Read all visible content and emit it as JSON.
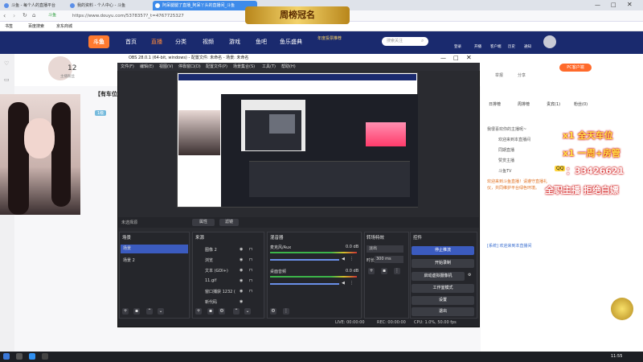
{
  "tabs": [
    {
      "label": "斗鱼 - 每个人的直播平台"
    },
    {
      "label": "我的资料 - 个人中心 - 斗鱼"
    },
    {
      "label": "阿呆腿腿了直播_阿呆丫头的直播间_斗鱼"
    }
  ],
  "address": {
    "secure_label": "斗鱼",
    "url": "https://www.douyu.com/5378357?_t=4767725327"
  },
  "bookmarks": [
    "书签",
    "百度搜索",
    "京东商城"
  ],
  "site": {
    "logo": "斗鱼",
    "nav": [
      "首页",
      "直播",
      "分类",
      "视频",
      "游戏",
      "鱼吧",
      "鱼乐盛典"
    ],
    "event_badge": "年度投票推荐",
    "search_placeholder": "搜索关注",
    "right_icons": [
      "登录",
      "开播",
      "客户端",
      "历史",
      "通知"
    ]
  },
  "streamer": {
    "followers": "12",
    "followers_label": "主播粉丝",
    "room_title": "【有车位",
    "level": "1级"
  },
  "banner": {
    "text": "周榜冠名"
  },
  "obs": {
    "window_title": "OBS 28.0.1 (64-bit, windows) - 配置文件: 未命名 - 场景: 未命名",
    "menu": [
      "文件(F)",
      "编辑(E)",
      "视图(V)",
      "停靠窗口(D)",
      "配置文件(P)",
      "场景集合(S)",
      "工具(T)",
      "帮助(H)"
    ],
    "no_source": "未选择源",
    "props_btn": "属性",
    "filters_btn": "滤镜",
    "scenes": {
      "title": "场景",
      "items": [
        "场景",
        "场景 2"
      ]
    },
    "sources": {
      "title": "来源",
      "items": [
        "图像 2",
        "浏览",
        "文本 (GDI+)",
        "11.gif",
        "窗口捕获 1232 (",
        "新代码"
      ]
    },
    "mixer": {
      "title": "混音器",
      "ch1_name": "麦克风/Aux",
      "ch1_db": "0.0 dB",
      "ch2_name": "桌面音频",
      "ch2_db": "0.0 dB"
    },
    "transitions": {
      "title": "转场特效",
      "type": "淡出",
      "duration_label": "时长",
      "duration_value": "300 ms"
    },
    "controls": {
      "title": "控件",
      "buttons": [
        "停止推流",
        "开始录制",
        "启动虚拟摄像机",
        "工作室模式",
        "设置",
        "退出"
      ]
    },
    "status": {
      "live": "LIVE: 00:00:00",
      "rec": "REC: 00:00:00",
      "cpu": "CPU: 1.0%, 50.00 fps"
    }
  },
  "right_panel": {
    "pc_btn": "PC客户端",
    "room_links": [
      "举报",
      "分享"
    ],
    "tabs": [
      "日排榜",
      "周排榜",
      "贵宾(1)",
      "粉丝(0)"
    ],
    "chat": [
      "我很喜欢你的主播呢~",
      "欢迎来到本直播间",
      "同期直播",
      "赞赏主播",
      "斗鱼TV",
      "欢迎来到斗鱼直播！请遵守直播礼仪，共同维护平台绿色环境。",
      "[系统] 欢迎来到本直播间"
    ],
    "promo": {
      "line1": "x1 全天车位",
      "line2": "x1 一周+房管",
      "line3": "：33426621",
      "line4": "全职主播 拒绝白嫖",
      "id_label": "QQ"
    }
  },
  "taskbar": {
    "time": "11:55"
  }
}
